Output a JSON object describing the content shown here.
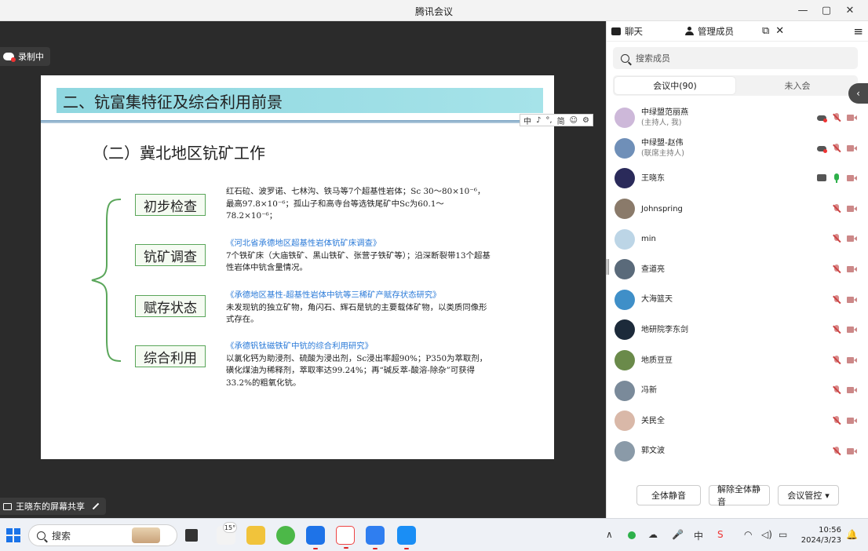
{
  "window": {
    "title": "腾讯会议",
    "controls": [
      "—",
      "▢",
      "✕"
    ]
  },
  "recording": {
    "label": "录制中"
  },
  "slide": {
    "heading": "二、钪富集特征及综合利用前景",
    "subtitle": "（二）冀北地区钪矿工作",
    "items": [
      {
        "label": "初步检查",
        "ref": "",
        "text": "红石砬、波罗诺、七林沟、铁马等7个超基性岩体；Sc 30～80×10⁻⁶，最高97.8×10⁻⁶；孤山子和高寺台等选铁尾矿中Sc为60.1～78.2×10⁻⁶；"
      },
      {
        "label": "钪矿调查",
        "ref": "《河北省承德地区超基性岩体钪矿床调查》",
        "text": "7个铁矿床（大庙铁矿、黑山铁矿、张营子铁矿等）；沿深断裂带13个超基性岩体中钪含量情况。"
      },
      {
        "label": "赋存状态",
        "ref": "《承德地区基性-超基性岩体中钪等三稀矿产赋存状态研究》",
        "text": "未发现钪的独立矿物，角闪石、辉石是钪的主要载体矿物，以类质同像形式存在。"
      },
      {
        "label": "综合利用",
        "ref": "《承德钒钛磁铁矿中钪的综合利用研究》",
        "text": "以氯化钙为助浸剂、硫酸为浸出剂，Sc浸出率超90%；P350为萃取剂，磺化煤油为稀释剂，萃取率达99.24%；再“碱反萃-酸溶-除杂”可获得33.2%的粗氧化钪。"
      }
    ]
  },
  "ime": {
    "items": [
      "中",
      "♪",
      "°,",
      "简",
      "☺",
      "⚙"
    ]
  },
  "share": {
    "label": "王晓东的屏幕共享"
  },
  "panel": {
    "tab_chat": "聊天",
    "tab_members": "管理成员",
    "search_placeholder": "搜索成员",
    "seg_in": "会议中(90)",
    "seg_out": "未入会",
    "members": [
      {
        "name": "中绿盟范丽燕",
        "sub": "(主持人, 我)",
        "color": "#cdb8d9",
        "icons": [
          "cloud",
          "mic-off",
          "cam-off"
        ]
      },
      {
        "name": "中绿盟-赵伟",
        "sub": "(联席主持人)",
        "color": "#6f8fb8",
        "icons": [
          "cloud",
          "mic-off",
          "cam-off"
        ]
      },
      {
        "name": "王晓东",
        "sub": "",
        "color": "#2a2a5a",
        "icons": [
          "screen",
          "mic-on",
          "cam-off"
        ]
      },
      {
        "name": "Johnspring",
        "sub": "",
        "color": "#8a7a6a",
        "icons": [
          "mic-off",
          "cam-off"
        ]
      },
      {
        "name": "min",
        "sub": "",
        "color": "#bcd5e6",
        "icons": [
          "mic-off",
          "cam-off"
        ]
      },
      {
        "name": "查道亮",
        "sub": "",
        "color": "#5a6a7a",
        "icons": [
          "mic-off",
          "cam-off"
        ]
      },
      {
        "name": "大海篮天",
        "sub": "",
        "color": "#3f8fc8",
        "icons": [
          "mic-off",
          "cam-off"
        ]
      },
      {
        "name": "地研院李东剑",
        "sub": "",
        "color": "#1c2a3a",
        "icons": [
          "mic-off",
          "cam-off"
        ]
      },
      {
        "name": "地质豆豆",
        "sub": "",
        "color": "#6a8a4a",
        "icons": [
          "mic-off",
          "cam-off"
        ]
      },
      {
        "name": "冯新",
        "sub": "",
        "color": "#7a8a9a",
        "icons": [
          "mic-off",
          "cam-off"
        ]
      },
      {
        "name": "关民全",
        "sub": "",
        "color": "#d9b8a8",
        "icons": [
          "mic-off",
          "cam-off"
        ]
      },
      {
        "name": "郭文波",
        "sub": "",
        "color": "#8a9aa8",
        "icons": [
          "mic-off",
          "cam-off"
        ]
      }
    ],
    "btn_mute_all": "全体静音",
    "btn_unmute_all": "解除全体静音",
    "btn_control": "会议管控"
  },
  "taskbar": {
    "search_label": "搜索",
    "badge": "15°",
    "time": "10:56",
    "date": "2024/3/23"
  }
}
